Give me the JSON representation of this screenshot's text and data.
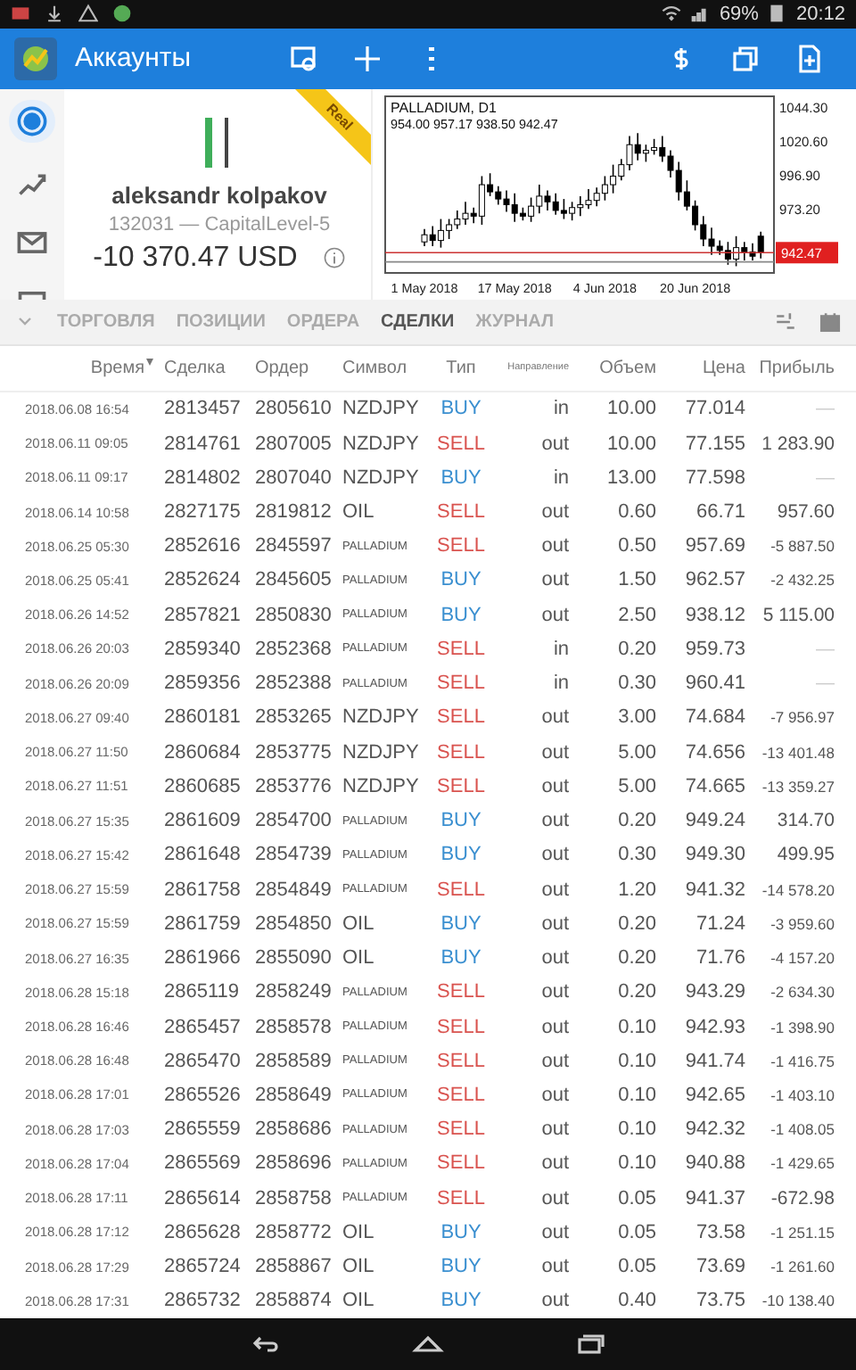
{
  "status_bar": {
    "battery": "69%",
    "time": "20:12"
  },
  "app_bar": {
    "title": "Аккаунты"
  },
  "side_nav": [
    {
      "kind": "account",
      "selected": true
    },
    {
      "kind": "trade",
      "selected": false
    },
    {
      "kind": "mail",
      "selected": false
    },
    {
      "kind": "news",
      "selected": false
    }
  ],
  "account": {
    "badge": "Real",
    "name": "aleksandr kolpakov",
    "number": "132031 — CapitalLevel-5",
    "balance": "-10 370.47 USD"
  },
  "chart": {
    "ohlc_text": "954.00 957.17 938.50 942.47",
    "price_label": "942.47",
    "chart_data": {
      "type": "candlestick",
      "title": "PALLADIUM, D1",
      "yticks": [
        {
          "value": 1044.3,
          "label": "1044.30"
        },
        {
          "value": 1020.6,
          "label": "1020.60"
        },
        {
          "value": 996.9,
          "label": "996.90"
        },
        {
          "value": 973.2,
          "label": "973.20"
        }
      ],
      "ylim": [
        928.3,
        1051.8
      ],
      "ref_lines": [
        {
          "axis": "y",
          "value": 942.47,
          "color": "#cc3333"
        },
        {
          "axis": "y",
          "value": 936,
          "color": "#888888"
        }
      ],
      "categories": [
        "1 May 2018",
        null,
        null,
        null,
        null,
        null,
        null,
        null,
        null,
        null,
        null,
        "17 May 2018",
        null,
        null,
        null,
        null,
        null,
        null,
        null,
        null,
        null,
        null,
        "4 Jun 2018",
        null,
        null,
        null,
        null,
        null,
        null,
        null,
        null,
        null,
        null,
        "20 Jun 2018",
        null,
        null,
        null,
        null,
        null,
        null,
        null,
        null
      ],
      "ohlc": [
        [
          950,
          959,
          947,
          955
        ],
        [
          955,
          961,
          947,
          951
        ],
        [
          951,
          966,
          946,
          958
        ],
        [
          958,
          966,
          952,
          962
        ],
        [
          962,
          972,
          959,
          966
        ],
        [
          966,
          978,
          962,
          970
        ],
        [
          970,
          974,
          963,
          968
        ],
        [
          968,
          996,
          962,
          990
        ],
        [
          990,
          998,
          982,
          985
        ],
        [
          985,
          989,
          976,
          980
        ],
        [
          980,
          986,
          971,
          976
        ],
        [
          976,
          984,
          964,
          970
        ],
        [
          970,
          974,
          965,
          968
        ],
        [
          968,
          981,
          964,
          975
        ],
        [
          975,
          990,
          970,
          982
        ],
        [
          982,
          986,
          972,
          978
        ],
        [
          978,
          984,
          969,
          972
        ],
        [
          972,
          980,
          966,
          970
        ],
        [
          970,
          978,
          965,
          974
        ],
        [
          974,
          982,
          968,
          976
        ],
        [
          976,
          987,
          973,
          979
        ],
        [
          979,
          988,
          975,
          984
        ],
        [
          984,
          996,
          979,
          990
        ],
        [
          990,
          1004,
          984,
          996
        ],
        [
          996,
          1008,
          993,
          1004
        ],
        [
          1004,
          1024,
          1000,
          1018
        ],
        [
          1018,
          1026,
          1007,
          1012
        ],
        [
          1012,
          1018,
          1006,
          1014
        ],
        [
          1014,
          1022,
          1011,
          1016
        ],
        [
          1016,
          1024,
          1006,
          1010
        ],
        [
          1010,
          1014,
          995,
          1000
        ],
        [
          1000,
          1006,
          979,
          985
        ],
        [
          985,
          993,
          972,
          975
        ],
        [
          975,
          979,
          958,
          962
        ],
        [
          962,
          968,
          947,
          952
        ],
        [
          952,
          960,
          941,
          947
        ],
        [
          947,
          951,
          941,
          944
        ],
        [
          944,
          950,
          934,
          938
        ],
        [
          938,
          954,
          933,
          946
        ],
        [
          946,
          950,
          937,
          943
        ],
        [
          943,
          949,
          937,
          940
        ],
        [
          954,
          957.17,
          938.5,
          942.47
        ]
      ]
    }
  },
  "tabs": [
    {
      "label": "ТОРГОВЛЯ",
      "selected": false
    },
    {
      "label": "ПОЗИЦИИ",
      "selected": false
    },
    {
      "label": "ОРДЕРА",
      "selected": false
    },
    {
      "label": "СДЕЛКИ",
      "selected": true
    },
    {
      "label": "ЖУРНАЛ",
      "selected": false
    }
  ],
  "table": {
    "columns": [
      {
        "label": "Время",
        "sorted": true
      },
      {
        "label": "Сделка",
        "sorted": false
      },
      {
        "label": "Ордер",
        "sorted": false
      },
      {
        "label": "Символ",
        "sorted": false
      },
      {
        "label": "Тип",
        "sorted": false
      },
      {
        "label": "Направление",
        "sorted": false
      },
      {
        "label": "Объем",
        "sorted": false
      },
      {
        "label": "Цена",
        "sorted": false
      },
      {
        "label": "Прибыль",
        "sorted": false
      }
    ],
    "rows": [
      {
        "time": "2018.06.08 16:54",
        "deal": "2813457",
        "order": "2805610",
        "symbol": "NZDJPY",
        "type": "BUY",
        "kind": "buy",
        "direction": "in",
        "volume": "10.00",
        "price": "77.014",
        "profit": "—"
      },
      {
        "time": "2018.06.11 09:05",
        "deal": "2814761",
        "order": "2807005",
        "symbol": "NZDJPY",
        "type": "SELL",
        "kind": "sell",
        "direction": "out",
        "volume": "10.00",
        "price": "77.155",
        "profit": "1 283.90"
      },
      {
        "time": "2018.06.11 09:17",
        "deal": "2814802",
        "order": "2807040",
        "symbol": "NZDJPY",
        "type": "BUY",
        "kind": "buy",
        "direction": "in",
        "volume": "13.00",
        "price": "77.598",
        "profit": "—"
      },
      {
        "time": "2018.06.14 10:58",
        "deal": "2827175",
        "order": "2819812",
        "symbol": "OIL",
        "type": "SELL",
        "kind": "sell",
        "direction": "out",
        "volume": "0.60",
        "price": "66.71",
        "profit": "957.60"
      },
      {
        "time": "2018.06.25 05:30",
        "deal": "2852616",
        "order": "2845597",
        "symbol": "PALLADIUM",
        "type": "SELL",
        "kind": "sell",
        "direction": "out",
        "volume": "0.50",
        "price": "957.69",
        "profit": "-5 887.50"
      },
      {
        "time": "2018.06.25 05:41",
        "deal": "2852624",
        "order": "2845605",
        "symbol": "PALLADIUM",
        "type": "BUY",
        "kind": "buy",
        "direction": "out",
        "volume": "1.50",
        "price": "962.57",
        "profit": "-2 432.25"
      },
      {
        "time": "2018.06.26 14:52",
        "deal": "2857821",
        "order": "2850830",
        "symbol": "PALLADIUM",
        "type": "BUY",
        "kind": "buy",
        "direction": "out",
        "volume": "2.50",
        "price": "938.12",
        "profit": "5 115.00"
      },
      {
        "time": "2018.06.26 20:03",
        "deal": "2859340",
        "order": "2852368",
        "symbol": "PALLADIUM",
        "type": "SELL",
        "kind": "sell",
        "direction": "in",
        "volume": "0.20",
        "price": "959.73",
        "profit": "—"
      },
      {
        "time": "2018.06.26 20:09",
        "deal": "2859356",
        "order": "2852388",
        "symbol": "PALLADIUM",
        "type": "SELL",
        "kind": "sell",
        "direction": "in",
        "volume": "0.30",
        "price": "960.41",
        "profit": "—"
      },
      {
        "time": "2018.06.27 09:40",
        "deal": "2860181",
        "order": "2853265",
        "symbol": "NZDJPY",
        "type": "SELL",
        "kind": "sell",
        "direction": "out",
        "volume": "3.00",
        "price": "74.684",
        "profit": "-7 956.97"
      },
      {
        "time": "2018.06.27 11:50",
        "deal": "2860684",
        "order": "2853775",
        "symbol": "NZDJPY",
        "type": "SELL",
        "kind": "sell",
        "direction": "out",
        "volume": "5.00",
        "price": "74.656",
        "profit": "-13 401.48"
      },
      {
        "time": "2018.06.27 11:51",
        "deal": "2860685",
        "order": "2853776",
        "symbol": "NZDJPY",
        "type": "SELL",
        "kind": "sell",
        "direction": "out",
        "volume": "5.00",
        "price": "74.665",
        "profit": "-13 359.27"
      },
      {
        "time": "2018.06.27 15:35",
        "deal": "2861609",
        "order": "2854700",
        "symbol": "PALLADIUM",
        "type": "BUY",
        "kind": "buy",
        "direction": "out",
        "volume": "0.20",
        "price": "949.24",
        "profit": "314.70"
      },
      {
        "time": "2018.06.27 15:42",
        "deal": "2861648",
        "order": "2854739",
        "symbol": "PALLADIUM",
        "type": "BUY",
        "kind": "buy",
        "direction": "out",
        "volume": "0.30",
        "price": "949.30",
        "profit": "499.95"
      },
      {
        "time": "2018.06.27 15:59",
        "deal": "2861758",
        "order": "2854849",
        "symbol": "PALLADIUM",
        "type": "SELL",
        "kind": "sell",
        "direction": "out",
        "volume": "1.20",
        "price": "941.32",
        "profit": "-14 578.20"
      },
      {
        "time": "2018.06.27 15:59",
        "deal": "2861759",
        "order": "2854850",
        "symbol": "OIL",
        "type": "BUY",
        "kind": "buy",
        "direction": "out",
        "volume": "0.20",
        "price": "71.24",
        "profit": "-3 959.60"
      },
      {
        "time": "2018.06.27 16:35",
        "deal": "2861966",
        "order": "2855090",
        "symbol": "OIL",
        "type": "BUY",
        "kind": "buy",
        "direction": "out",
        "volume": "0.20",
        "price": "71.76",
        "profit": "-4 157.20"
      },
      {
        "time": "2018.06.28 15:18",
        "deal": "2865119",
        "order": "2858249",
        "symbol": "PALLADIUM",
        "type": "SELL",
        "kind": "sell",
        "direction": "out",
        "volume": "0.20",
        "price": "943.29",
        "profit": "-2 634.30"
      },
      {
        "time": "2018.06.28 16:46",
        "deal": "2865457",
        "order": "2858578",
        "symbol": "PALLADIUM",
        "type": "SELL",
        "kind": "sell",
        "direction": "out",
        "volume": "0.10",
        "price": "942.93",
        "profit": "-1 398.90"
      },
      {
        "time": "2018.06.28 16:48",
        "deal": "2865470",
        "order": "2858589",
        "symbol": "PALLADIUM",
        "type": "SELL",
        "kind": "sell",
        "direction": "out",
        "volume": "0.10",
        "price": "941.74",
        "profit": "-1 416.75"
      },
      {
        "time": "2018.06.28 17:01",
        "deal": "2865526",
        "order": "2858649",
        "symbol": "PALLADIUM",
        "type": "SELL",
        "kind": "sell",
        "direction": "out",
        "volume": "0.10",
        "price": "942.65",
        "profit": "-1 403.10"
      },
      {
        "time": "2018.06.28 17:03",
        "deal": "2865559",
        "order": "2858686",
        "symbol": "PALLADIUM",
        "type": "SELL",
        "kind": "sell",
        "direction": "out",
        "volume": "0.10",
        "price": "942.32",
        "profit": "-1 408.05"
      },
      {
        "time": "2018.06.28 17:04",
        "deal": "2865569",
        "order": "2858696",
        "symbol": "PALLADIUM",
        "type": "SELL",
        "kind": "sell",
        "direction": "out",
        "volume": "0.10",
        "price": "940.88",
        "profit": "-1 429.65"
      },
      {
        "time": "2018.06.28 17:11",
        "deal": "2865614",
        "order": "2858758",
        "symbol": "PALLADIUM",
        "type": "SELL",
        "kind": "sell",
        "direction": "out",
        "volume": "0.05",
        "price": "941.37",
        "profit": "-672.98"
      },
      {
        "time": "2018.06.28 17:12",
        "deal": "2865628",
        "order": "2858772",
        "symbol": "OIL",
        "type": "BUY",
        "kind": "buy",
        "direction": "out",
        "volume": "0.05",
        "price": "73.58",
        "profit": "-1 251.15"
      },
      {
        "time": "2018.06.28 17:29",
        "deal": "2865724",
        "order": "2858867",
        "symbol": "OIL",
        "type": "BUY",
        "kind": "buy",
        "direction": "out",
        "volume": "0.05",
        "price": "73.69",
        "profit": "-1 261.60"
      },
      {
        "time": "2018.06.28 17:31",
        "deal": "2865732",
        "order": "2858874",
        "symbol": "OIL",
        "type": "BUY",
        "kind": "buy",
        "direction": "out",
        "volume": "0.40",
        "price": "73.75",
        "profit": "-10 138.40"
      }
    ]
  }
}
